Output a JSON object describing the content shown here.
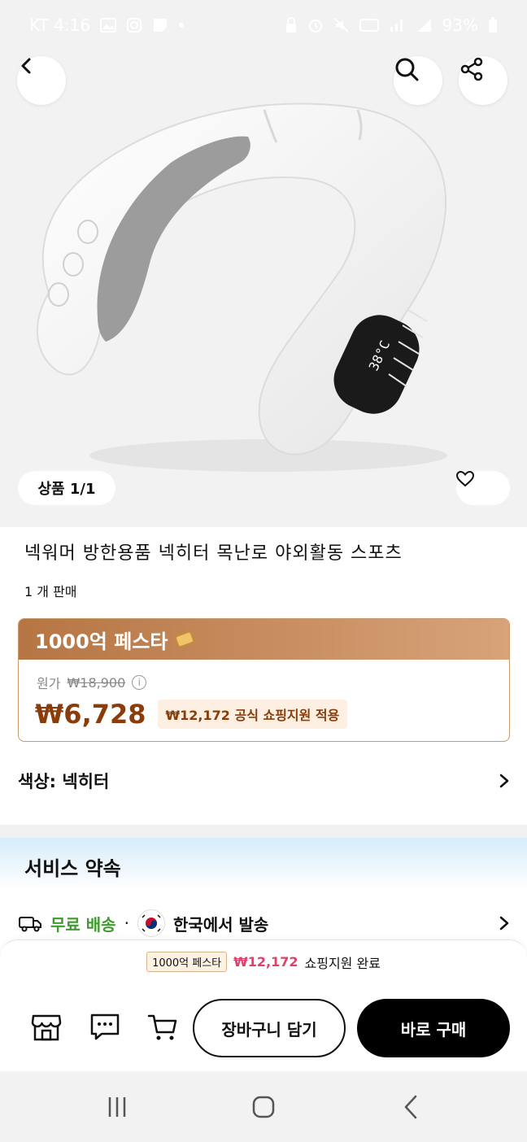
{
  "status_bar": {
    "carrier_time": "KT 4:16",
    "battery": "93%"
  },
  "gallery": {
    "counter": "상품 1/1",
    "device_display": "38°C"
  },
  "product": {
    "title": "넥워머 방한용품 넥히터 목난로 야외활동 스포츠",
    "sold": "1 개 판매"
  },
  "festa": {
    "label": "1000억 페스타",
    "original_label": "원가",
    "original_price": "₩18,900",
    "price": "₩6,728",
    "support_text": "₩12,172 공식 쇼핑지원 적용",
    "accent_color": "#8a3d0a"
  },
  "option": {
    "label": "색상: 넥히터"
  },
  "service": {
    "title": "서비스 약속",
    "free_shipping": "무료 배송",
    "separator": "·",
    "origin": "한국에서 발송"
  },
  "bottom_notice": {
    "tag": "1000억 페스타",
    "amount": "₩12,172",
    "text": "쇼핑지원 완료"
  },
  "actions": {
    "cart_label": "장바구니 담기",
    "buy_label": "바로 구매"
  },
  "icons": {
    "back": "back-arrow-icon",
    "search": "search-icon",
    "share": "share-icon",
    "heart": "heart-icon",
    "store": "store-icon",
    "chat": "chat-icon",
    "cart": "cart-icon",
    "truck": "truck-icon"
  }
}
